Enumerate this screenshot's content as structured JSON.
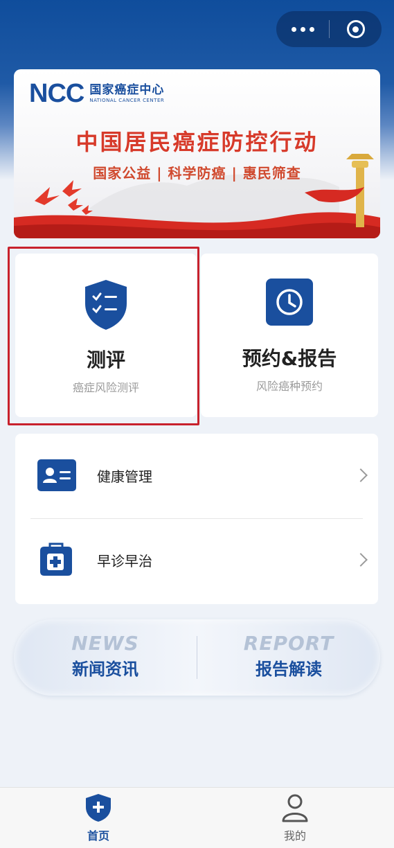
{
  "topbar": {
    "more_icon": "more-dots-icon",
    "close_icon": "target-circle-icon"
  },
  "banner": {
    "logo_mark": "NCC",
    "logo_cn": "国家癌症中心",
    "logo_en": "NATIONAL CANCER CENTER",
    "title": "中国居民癌症防控行动",
    "subtitle": "国家公益 | 科学防癌 | 惠民筛查",
    "accent": "#d73a2a"
  },
  "cards": [
    {
      "title": "测评",
      "subtitle": "癌症风险测评",
      "icon": "shield-checklist-icon",
      "highlighted": true
    },
    {
      "title": "预约&报告",
      "subtitle": "风险癌种预约",
      "icon": "clock-icon",
      "highlighted": false
    }
  ],
  "menu": [
    {
      "label": "健康管理",
      "icon": "id-card-icon"
    },
    {
      "label": "早诊早治",
      "icon": "medical-kit-icon"
    }
  ],
  "news_pill": {
    "left_en": "NEWS",
    "left_cn": "新闻资讯",
    "right_en": "REPORT",
    "right_cn": "报告解读"
  },
  "tabbar": {
    "home_label": "首页",
    "mine_label": "我的",
    "active_color": "#1a4f9e"
  },
  "colors": {
    "brand": "#1a4f9e",
    "highlight_border": "#c8212c"
  }
}
